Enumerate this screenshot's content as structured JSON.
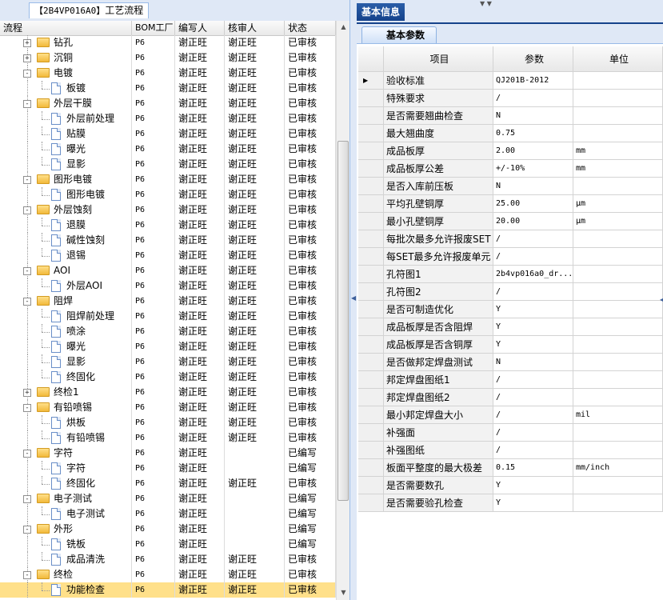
{
  "left_panel": {
    "tab_tag": "【2B4VP016A0】",
    "tab_label": "工艺流程",
    "columns": [
      "流程",
      "BOM工厂",
      "编写人",
      "核审人",
      "状态"
    ],
    "rows": [
      {
        "level": 1,
        "kind": "folder",
        "expand": "+",
        "name": "钻孔",
        "bom": "P6",
        "writer": "谢正旺",
        "reviewer": "谢正旺",
        "status": "已审核"
      },
      {
        "level": 1,
        "kind": "folder",
        "expand": "+",
        "name": "沉铜",
        "bom": "P6",
        "writer": "谢正旺",
        "reviewer": "谢正旺",
        "status": "已审核"
      },
      {
        "level": 1,
        "kind": "folder",
        "expand": "-",
        "name": "电镀",
        "bom": "P6",
        "writer": "谢正旺",
        "reviewer": "谢正旺",
        "status": "已审核"
      },
      {
        "level": 2,
        "kind": "doc",
        "name": "板镀",
        "bom": "P6",
        "writer": "谢正旺",
        "reviewer": "谢正旺",
        "status": "已审核"
      },
      {
        "level": 1,
        "kind": "folder",
        "expand": "-",
        "name": "外层干膜",
        "bom": "P6",
        "writer": "谢正旺",
        "reviewer": "谢正旺",
        "status": "已审核"
      },
      {
        "level": 2,
        "kind": "doc",
        "name": "外层前处理",
        "bom": "P6",
        "writer": "谢正旺",
        "reviewer": "谢正旺",
        "status": "已审核"
      },
      {
        "level": 2,
        "kind": "doc",
        "name": "贴膜",
        "bom": "P6",
        "writer": "谢正旺",
        "reviewer": "谢正旺",
        "status": "已审核"
      },
      {
        "level": 2,
        "kind": "doc",
        "name": "曝光",
        "bom": "P6",
        "writer": "谢正旺",
        "reviewer": "谢正旺",
        "status": "已审核"
      },
      {
        "level": 2,
        "kind": "doc",
        "name": "显影",
        "bom": "P6",
        "writer": "谢正旺",
        "reviewer": "谢正旺",
        "status": "已审核"
      },
      {
        "level": 1,
        "kind": "folder",
        "expand": "-",
        "name": "图形电镀",
        "bom": "P6",
        "writer": "谢正旺",
        "reviewer": "谢正旺",
        "status": "已审核"
      },
      {
        "level": 2,
        "kind": "doc",
        "name": "图形电镀",
        "bom": "P6",
        "writer": "谢正旺",
        "reviewer": "谢正旺",
        "status": "已审核"
      },
      {
        "level": 1,
        "kind": "folder",
        "expand": "-",
        "name": "外层蚀刻",
        "bom": "P6",
        "writer": "谢正旺",
        "reviewer": "谢正旺",
        "status": "已审核"
      },
      {
        "level": 2,
        "kind": "doc",
        "name": "退膜",
        "bom": "P6",
        "writer": "谢正旺",
        "reviewer": "谢正旺",
        "status": "已审核"
      },
      {
        "level": 2,
        "kind": "doc",
        "name": "碱性蚀刻",
        "bom": "P6",
        "writer": "谢正旺",
        "reviewer": "谢正旺",
        "status": "已审核"
      },
      {
        "level": 2,
        "kind": "doc",
        "name": "退锡",
        "bom": "P6",
        "writer": "谢正旺",
        "reviewer": "谢正旺",
        "status": "已审核"
      },
      {
        "level": 1,
        "kind": "folder",
        "expand": "-",
        "name": "AOI",
        "bom": "P6",
        "writer": "谢正旺",
        "reviewer": "谢正旺",
        "status": "已审核"
      },
      {
        "level": 2,
        "kind": "doc",
        "name": "外层AOI",
        "bom": "P6",
        "writer": "谢正旺",
        "reviewer": "谢正旺",
        "status": "已审核"
      },
      {
        "level": 1,
        "kind": "folder",
        "expand": "-",
        "name": "阻焊",
        "bom": "P6",
        "writer": "谢正旺",
        "reviewer": "谢正旺",
        "status": "已审核"
      },
      {
        "level": 2,
        "kind": "doc",
        "name": "阻焊前处理",
        "bom": "P6",
        "writer": "谢正旺",
        "reviewer": "谢正旺",
        "status": "已审核"
      },
      {
        "level": 2,
        "kind": "doc",
        "name": "喷涂",
        "bom": "P6",
        "writer": "谢正旺",
        "reviewer": "谢正旺",
        "status": "已审核"
      },
      {
        "level": 2,
        "kind": "doc",
        "name": "曝光",
        "bom": "P6",
        "writer": "谢正旺",
        "reviewer": "谢正旺",
        "status": "已审核"
      },
      {
        "level": 2,
        "kind": "doc",
        "name": "显影",
        "bom": "P6",
        "writer": "谢正旺",
        "reviewer": "谢正旺",
        "status": "已审核"
      },
      {
        "level": 2,
        "kind": "doc",
        "name": "终固化",
        "bom": "P6",
        "writer": "谢正旺",
        "reviewer": "谢正旺",
        "status": "已审核"
      },
      {
        "level": 1,
        "kind": "folder",
        "expand": "+",
        "name": "终检1",
        "bom": "P6",
        "writer": "谢正旺",
        "reviewer": "谢正旺",
        "status": "已审核"
      },
      {
        "level": 1,
        "kind": "folder",
        "expand": "-",
        "name": "有铅喷锡",
        "bom": "P6",
        "writer": "谢正旺",
        "reviewer": "谢正旺",
        "status": "已审核"
      },
      {
        "level": 2,
        "kind": "doc",
        "name": "烘板",
        "bom": "P6",
        "writer": "谢正旺",
        "reviewer": "谢正旺",
        "status": "已审核"
      },
      {
        "level": 2,
        "kind": "doc",
        "name": "有铅喷锡",
        "bom": "P6",
        "writer": "谢正旺",
        "reviewer": "谢正旺",
        "status": "已审核"
      },
      {
        "level": 1,
        "kind": "folder",
        "expand": "-",
        "name": "字符",
        "bom": "P6",
        "writer": "谢正旺",
        "reviewer": "",
        "status": "已编写"
      },
      {
        "level": 2,
        "kind": "doc",
        "name": "字符",
        "bom": "P6",
        "writer": "谢正旺",
        "reviewer": "",
        "status": "已编写"
      },
      {
        "level": 2,
        "kind": "doc",
        "name": "终固化",
        "bom": "P6",
        "writer": "谢正旺",
        "reviewer": "谢正旺",
        "status": "已审核"
      },
      {
        "level": 1,
        "kind": "folder",
        "expand": "-",
        "name": "电子测试",
        "bom": "P6",
        "writer": "谢正旺",
        "reviewer": "",
        "status": "已编写"
      },
      {
        "level": 2,
        "kind": "doc",
        "name": "电子测试",
        "bom": "P6",
        "writer": "谢正旺",
        "reviewer": "",
        "status": "已编写"
      },
      {
        "level": 1,
        "kind": "folder",
        "expand": "-",
        "name": "外形",
        "bom": "P6",
        "writer": "谢正旺",
        "reviewer": "",
        "status": "已编写"
      },
      {
        "level": 2,
        "kind": "doc",
        "name": "铣板",
        "bom": "P6",
        "writer": "谢正旺",
        "reviewer": "",
        "status": "已编写"
      },
      {
        "level": 2,
        "kind": "doc",
        "name": "成品清洗",
        "bom": "P6",
        "writer": "谢正旺",
        "reviewer": "谢正旺",
        "status": "已审核"
      },
      {
        "level": 1,
        "kind": "folder",
        "expand": "-",
        "name": "终检",
        "bom": "P6",
        "writer": "谢正旺",
        "reviewer": "谢正旺",
        "status": "已审核"
      },
      {
        "level": 2,
        "kind": "doc",
        "name": "功能检查",
        "bom": "P6",
        "writer": "谢正旺",
        "reviewer": "谢正旺",
        "status": "已审核",
        "selected": true
      }
    ]
  },
  "right_panel": {
    "title": "基本信息",
    "subtab": "基本参数",
    "columns": [
      "项目",
      "参数",
      "单位"
    ],
    "rows": [
      {
        "name": "验收标准",
        "value": "QJ201B-2012",
        "unit": "",
        "current": true
      },
      {
        "name": "特殊要求",
        "value": "/",
        "unit": ""
      },
      {
        "name": "是否需要翘曲检查",
        "value": "N",
        "unit": ""
      },
      {
        "name": "最大翘曲度",
        "value": "0.75",
        "unit": ""
      },
      {
        "name": "成品板厚",
        "value": "2.00",
        "unit": "mm"
      },
      {
        "name": "成品板厚公差",
        "value": "+/-10%",
        "unit": "mm"
      },
      {
        "name": "是否入库前压板",
        "value": "N",
        "unit": ""
      },
      {
        "name": "平均孔壁铜厚",
        "value": "25.00",
        "unit": "μm"
      },
      {
        "name": "最小孔壁铜厚",
        "value": "20.00",
        "unit": "μm"
      },
      {
        "name": "每批次最多允许报废SET",
        "value": "/",
        "unit": ""
      },
      {
        "name": "每SET最多允许报废单元",
        "value": "/",
        "unit": ""
      },
      {
        "name": "孔符图1",
        "value": "2b4vp016a0_dr...",
        "unit": ""
      },
      {
        "name": "孔符图2",
        "value": "/",
        "unit": ""
      },
      {
        "name": "是否可制造优化",
        "value": "Y",
        "unit": ""
      },
      {
        "name": "成品板厚是否含阻焊",
        "value": "Y",
        "unit": ""
      },
      {
        "name": "成品板厚是否含铜厚",
        "value": "Y",
        "unit": ""
      },
      {
        "name": "是否做邦定焊盘测试",
        "value": "N",
        "unit": ""
      },
      {
        "name": "邦定焊盘图纸1",
        "value": "/",
        "unit": ""
      },
      {
        "name": "邦定焊盘图纸2",
        "value": "/",
        "unit": ""
      },
      {
        "name": "最小邦定焊盘大小",
        "value": "/",
        "unit": "mil"
      },
      {
        "name": "补强面",
        "value": "/",
        "unit": ""
      },
      {
        "name": "补强图纸",
        "value": "/",
        "unit": ""
      },
      {
        "name": "板面平整度的最大极差",
        "value": "0.15",
        "unit": "mm/inch"
      },
      {
        "name": "是否需要数孔",
        "value": "Y",
        "unit": ""
      },
      {
        "name": "是否需要验孔检查",
        "value": "Y",
        "unit": ""
      }
    ]
  }
}
